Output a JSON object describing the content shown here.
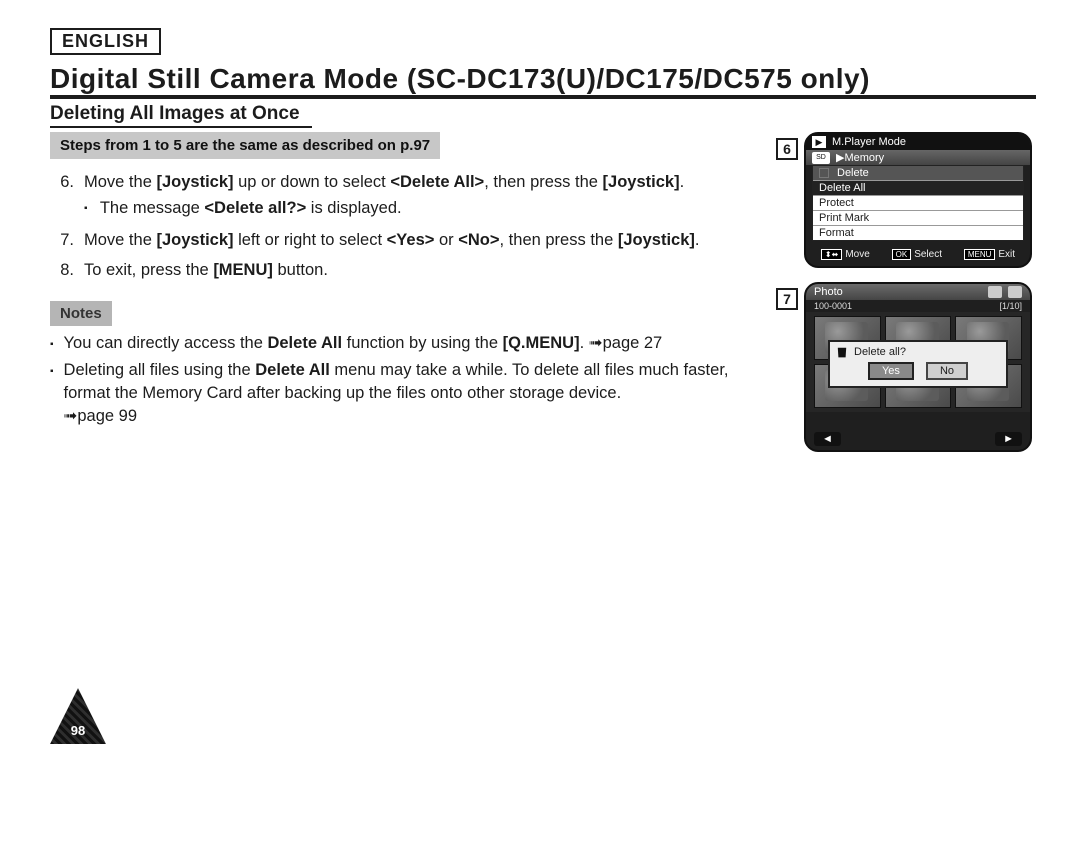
{
  "lang_label": "ENGLISH",
  "chapter_title": "Digital Still Camera Mode (SC-DC173(U)/DC175/DC575 only)",
  "section_title": "Deleting All Images at Once",
  "shade_intro": "Steps from 1 to 5 are the same as described on p.97",
  "steps": [
    {
      "n": "6.",
      "text_parts": [
        "Move the ",
        "[Joystick]",
        " up or down to select ",
        "<Delete All>",
        ", then press the ",
        "[Joystick]",
        "."
      ],
      "sub": [
        [
          "The message ",
          "<Delete all?>",
          " is displayed."
        ]
      ]
    },
    {
      "n": "7.",
      "text_parts": [
        "Move the ",
        "[Joystick]",
        " left or right to select ",
        "<Yes>",
        " or ",
        "<No>",
        ", then press the ",
        "[Joystick]",
        "."
      ]
    },
    {
      "n": "8.",
      "text_parts": [
        "To exit, press the ",
        "[MENU]",
        " button."
      ]
    }
  ],
  "notes_label": "Notes",
  "notes": [
    [
      "You can directly access the ",
      "Delete All",
      " function by using the ",
      "[Q.MENU]",
      ". ",
      "➟",
      "page 27"
    ],
    [
      "Deleting all files using the ",
      "Delete All",
      " menu may take a while. To delete all files much faster, format the Memory Card after backing up the files onto other storage device. ",
      "➟",
      "page 99"
    ]
  ],
  "fig6": {
    "callout": "6",
    "title": "M.Player Mode",
    "memory_label": "▶Memory",
    "menu": {
      "head": "Delete",
      "items": [
        "Delete All",
        "Protect",
        "Print Mark",
        "Format"
      ],
      "selected_index": 0
    },
    "footer": {
      "move": "Move",
      "select": "Select",
      "exit": "Exit",
      "move_btn": "⬍⬌",
      "select_btn": "OK",
      "exit_btn": "MENU"
    }
  },
  "fig7": {
    "callout": "7",
    "topbar_label": "Photo",
    "meta_left": "100-0001",
    "meta_right": "[1/10]",
    "dialog_text": "Delete all?",
    "yes": "Yes",
    "no": "No",
    "arrow_left": "◄",
    "arrow_right": "►"
  },
  "page_number": "98"
}
